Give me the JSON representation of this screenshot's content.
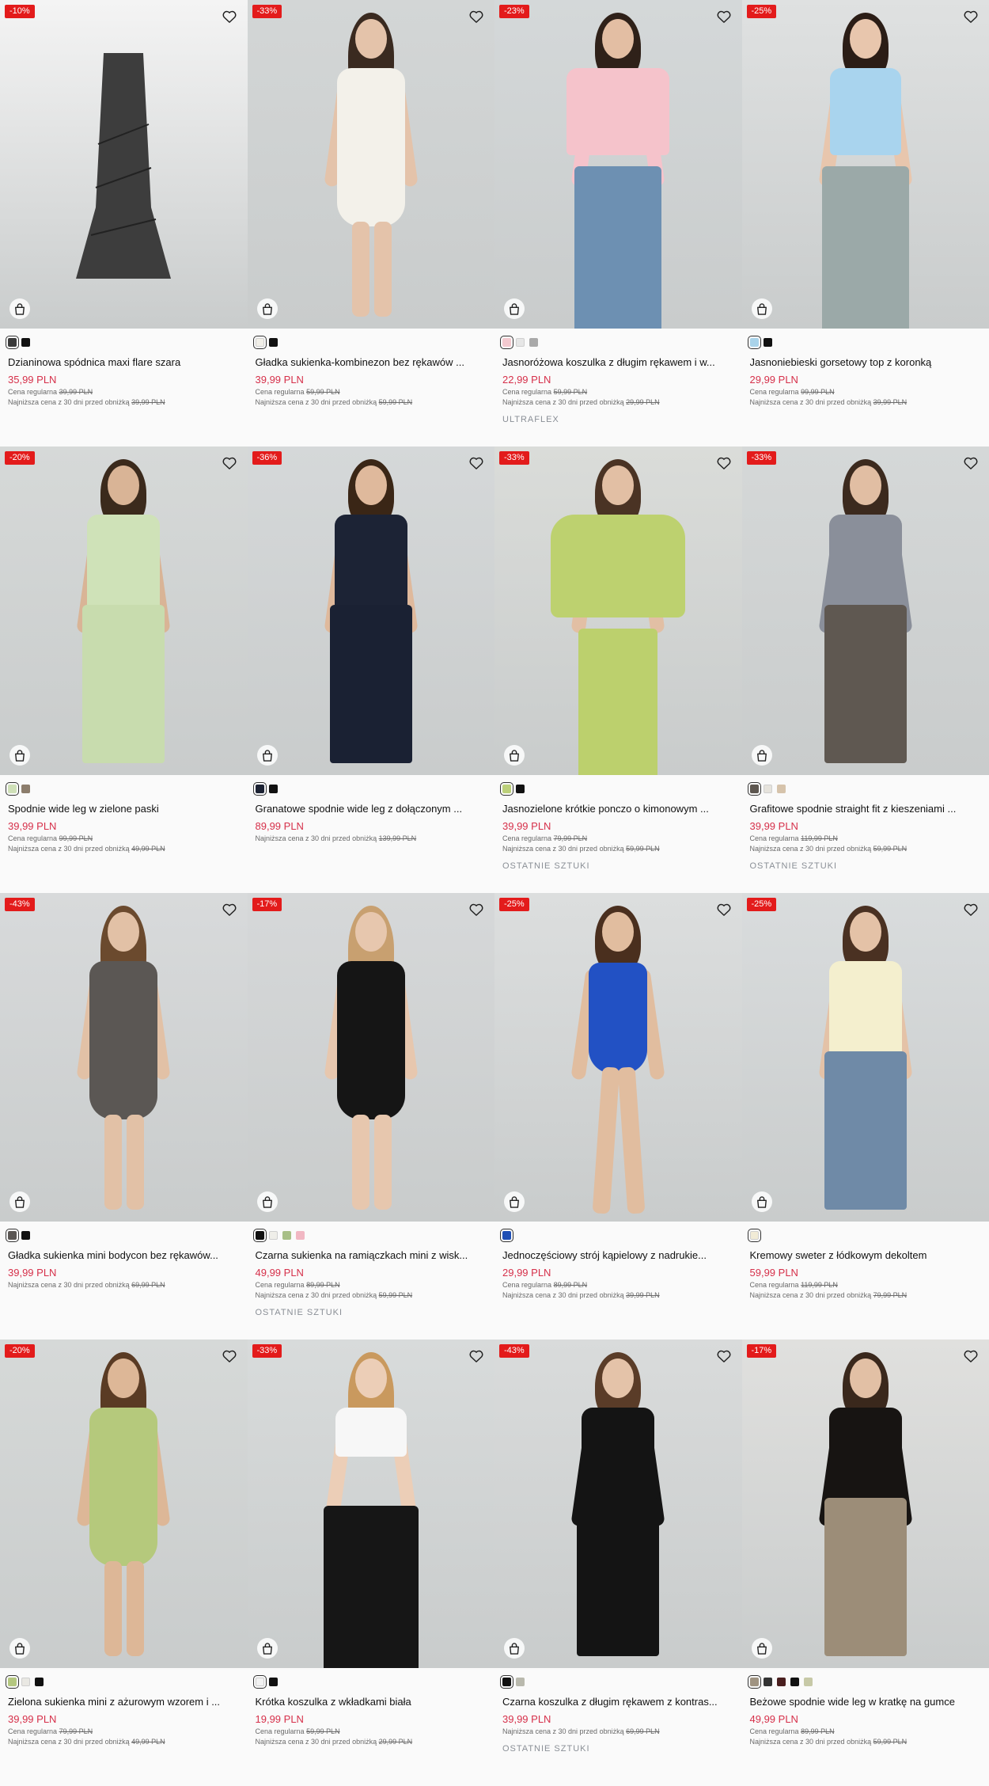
{
  "labels": {
    "regular": "Cena regularna",
    "lowest": "Najniższa cena z 30 dni przed obniżką"
  },
  "products": [
    {
      "badge": "-10%",
      "name": "Dzianinowa spódnica maxi flare szara",
      "price": "35,99 PLN",
      "regular": "39,99 PLN",
      "lowest": "39,99 PLN",
      "tag": "",
      "swatches": [
        "#3a3a3a",
        "#111111"
      ],
      "photo": {
        "bg": "#f4f4f4",
        "kind": "flat",
        "top": "#3d3d3d",
        "bottom": "#3d3d3d",
        "hair": "",
        "skin": ""
      }
    },
    {
      "badge": "-33%",
      "name": "Gładka sukienka-kombinezon bez rękawów ...",
      "price": "39,99 PLN",
      "regular": "59,99 PLN",
      "lowest": "59,99 PLN",
      "tag": "",
      "swatches": [
        "#f1efe8",
        "#111111"
      ],
      "photo": {
        "bg": "#d3d6d6",
        "kind": "dress",
        "top": "#f3f1ea",
        "bottom": "#f3f1ea",
        "hair": "#3a2a20",
        "skin": "#e4c3aa"
      }
    },
    {
      "badge": "-23%",
      "name": "Jasnoróżowa koszulka z długim rękawem i w...",
      "price": "22,99 PLN",
      "regular": "59,99 PLN",
      "lowest": "29,99 PLN",
      "tag": "ULTRAFLEX",
      "swatches": [
        "#f3c9cf",
        "#e6e6e6",
        "#a9a9a9"
      ],
      "photo": {
        "bg": "#d4d8d9",
        "kind": "back",
        "top": "#f5c3cb",
        "bottom": "#6d90b2",
        "hair": "#2f2119",
        "skin": "#e3bea3"
      }
    },
    {
      "badge": "-25%",
      "name": "Jasnoniebieski gorsetowy top z koronką",
      "price": "29,99 PLN",
      "regular": "99,99 PLN",
      "lowest": "39,99 PLN",
      "tag": "",
      "swatches": [
        "#a9d3ea",
        "#111111"
      ],
      "photo": {
        "bg": "#dfe1e1",
        "kind": "corset",
        "top": "#a9d4ee",
        "bottom": "#9ba9a8",
        "hair": "#2b1d16",
        "skin": "#e8c6ad"
      }
    },
    {
      "badge": "-20%",
      "name": "Spodnie wide leg w zielone paski",
      "price": "39,99 PLN",
      "regular": "99,99 PLN",
      "lowest": "49,99 PLN",
      "tag": "",
      "swatches": [
        "#cfe0b8",
        "#8c7d6c"
      ],
      "photo": {
        "bg": "#d6d9d8",
        "kind": "set",
        "top": "#cfe2b8",
        "bottom": "#c8dcae",
        "hair": "#3b2a1c",
        "skin": "#d9b496"
      }
    },
    {
      "badge": "-36%",
      "name": "Granatowe spodnie wide leg z dołączonym ...",
      "price": "89,99 PLN",
      "regular": "",
      "lowest": "139,99 PLN",
      "tag": "",
      "swatches": [
        "#1c2233",
        "#111111"
      ],
      "photo": {
        "bg": "#d5d8d9",
        "kind": "set",
        "top": "#1c2335",
        "bottom": "#1a2133",
        "hair": "#3a2616",
        "skin": "#dfb99c"
      }
    },
    {
      "badge": "-33%",
      "name": "Jasnozielone krótkie ponczo o kimonowym ...",
      "price": "39,99 PLN",
      "regular": "79,99 PLN",
      "lowest": "59,99 PLN",
      "tag": "OSTATNIE SZTUKI",
      "swatches": [
        "#bcd07a",
        "#111111"
      ],
      "photo": {
        "bg": "#dadcd9",
        "kind": "poncho",
        "top": "#bdd16f",
        "bottom": "#bcd06d",
        "hair": "#4a3324",
        "skin": "#e2bfa4"
      }
    },
    {
      "badge": "-33%",
      "name": "Grafitowe spodnie straight fit z kieszeniami ...",
      "price": "39,99 PLN",
      "regular": "119,99 PLN",
      "lowest": "59,99 PLN",
      "tag": "OSTATNIE SZTUKI",
      "swatches": [
        "#5d564f",
        "#e6e3dc",
        "#d6c3ab"
      ],
      "photo": {
        "bg": "#d5d8d8",
        "kind": "set",
        "top": "#8a8f9a",
        "bottom": "#5f5851",
        "hair": "#3c2a1e",
        "skin": "#e1bea3"
      }
    },
    {
      "badge": "-43%",
      "name": "Gładka sukienka mini bodycon bez rękawów...",
      "price": "39,99 PLN",
      "regular": "",
      "lowest": "69,99 PLN",
      "tag": "",
      "swatches": [
        "#5a5653",
        "#111111"
      ],
      "photo": {
        "bg": "#d8dadb",
        "kind": "dress",
        "top": "#5b5754",
        "bottom": "#5b5754",
        "hair": "#6b4a2e",
        "skin": "#e2c1a6"
      }
    },
    {
      "badge": "-17%",
      "name": "Czarna sukienka na ramiączkach mini z wisk...",
      "price": "49,99 PLN",
      "regular": "89,99 PLN",
      "lowest": "59,99 PLN",
      "tag": "OSTATNIE SZTUKI",
      "swatches": [
        "#111111",
        "#efeee9",
        "#a8bf87",
        "#f1b7c3"
      ],
      "photo": {
        "bg": "#d6d8d9",
        "kind": "dress",
        "top": "#151515",
        "bottom": "#151515",
        "hair": "#c8a070",
        "skin": "#e7c7ae"
      }
    },
    {
      "badge": "-25%",
      "name": "Jednoczęściowy strój kąpielowy z nadrukie...",
      "price": "29,99 PLN",
      "regular": "89,99 PLN",
      "lowest": "39,99 PLN",
      "tag": "",
      "swatches": [
        "#1f4fb5"
      ],
      "photo": {
        "bg": "#dcdede",
        "kind": "swim",
        "top": "#2251c4",
        "bottom": "#2251c4",
        "hair": "#4a2f1e",
        "skin": "#e1bd9f"
      }
    },
    {
      "badge": "-25%",
      "name": "Kremowy sweter z łódkowym dekoltem",
      "price": "59,99 PLN",
      "regular": "119,99 PLN",
      "lowest": "79,99 PLN",
      "tag": "",
      "swatches": [
        "#f1ebd6"
      ],
      "photo": {
        "bg": "#d9dcdd",
        "kind": "set",
        "top": "#f4efce",
        "bottom": "#6f8aa7",
        "hair": "#4a3122",
        "skin": "#e4c2a7"
      }
    },
    {
      "badge": "-20%",
      "name": "Zielona sukienka mini z ażurowym wzorem i ...",
      "price": "39,99 PLN",
      "regular": "79,99 PLN",
      "lowest": "49,99 PLN",
      "tag": "",
      "swatches": [
        "#b4c77f",
        "#e9e8e3",
        "#111111"
      ],
      "photo": {
        "bg": "#d6d9d8",
        "kind": "dress",
        "top": "#b5c97c",
        "bottom": "#b5c97c",
        "hair": "#5a3b24",
        "skin": "#ddb797"
      }
    },
    {
      "badge": "-33%",
      "name": "Krótka koszulka z wkładkami biała",
      "price": "19,99 PLN",
      "regular": "59,99 PLN",
      "lowest": "29,99 PLN",
      "tag": "",
      "swatches": [
        "#f2f2f2",
        "#111111"
      ],
      "photo": {
        "bg": "#d8dbdb",
        "kind": "crop",
        "top": "#f7f7f7",
        "bottom": "#161616",
        "hair": "#c9995e",
        "skin": "#ecceb7"
      }
    },
    {
      "badge": "-43%",
      "name": "Czarna koszulka z długim rękawem z kontras...",
      "price": "39,99 PLN",
      "regular": "",
      "lowest": "69,99 PLN",
      "tag": "OSTATNIE SZTUKI",
      "swatches": [
        "#111111",
        "#b9b9ad"
      ],
      "photo": {
        "bg": "#d9dbdb",
        "kind": "set",
        "top": "#141414",
        "bottom": "#141414",
        "hair": "#5a3c28",
        "skin": "#e4c3a9"
      }
    },
    {
      "badge": "-17%",
      "name": "Beżowe spodnie wide leg w kratkę na gumce",
      "price": "49,99 PLN",
      "regular": "89,99 PLN",
      "lowest": "59,99 PLN",
      "tag": "",
      "swatches": [
        "#a09482",
        "#333333",
        "#4a1f1f",
        "#111111",
        "#c7c9a7"
      ],
      "photo": {
        "bg": "#e0e0de",
        "kind": "set",
        "top": "#171412",
        "bottom": "#9c8d78",
        "hair": "#3a281c",
        "skin": "#e2c0a5"
      }
    }
  ]
}
